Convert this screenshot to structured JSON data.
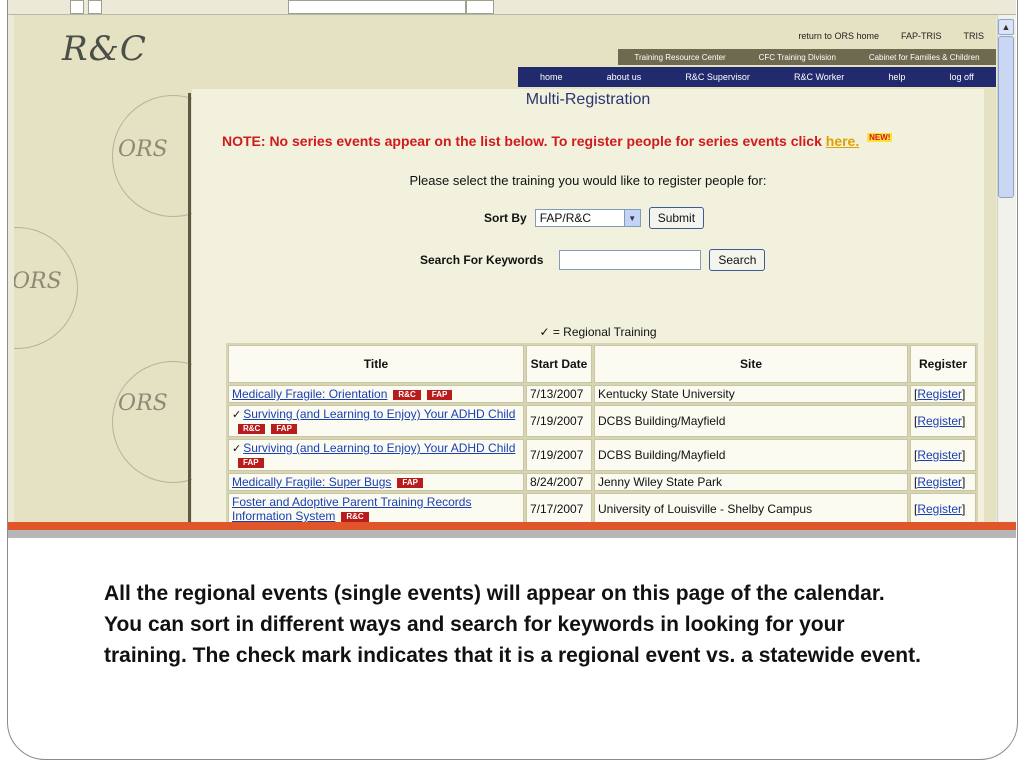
{
  "site": {
    "logo": "R&C",
    "watermark": "ORS"
  },
  "top_links": [
    "return to ORS home",
    "FAP-TRIS",
    "TRIS"
  ],
  "nav_secondary": [
    "Training Resource Center",
    "CFC Training Division",
    "Cabinet for Families & Children"
  ],
  "nav_primary": [
    "home",
    "about us",
    "R&C Supervisor",
    "R&C Worker",
    "help",
    "log off"
  ],
  "page": {
    "heading": "Multi-Registration",
    "note_text": "NOTE: No series events appear on the list below. To register people for series events click",
    "note_link": "here.",
    "note_badge": "NEW!",
    "prompt": "Please select the training you would like to register people for:",
    "sort_label": "Sort By",
    "sort_value": "FAP/R&C",
    "submit_label": "Submit",
    "search_label": "Search For Keywords",
    "search_value": "",
    "search_button": "Search",
    "legend": "✓ = Regional Training"
  },
  "table": {
    "headers": [
      "Title",
      "Start Date",
      "Site",
      "Register"
    ],
    "rows": [
      {
        "regional": false,
        "title": "Medically Fragile: Orientation",
        "badges": [
          "R&C",
          "FAP"
        ],
        "date": "7/13/2007",
        "site": "Kentucky State University",
        "register": "Register"
      },
      {
        "regional": true,
        "title": "Surviving (and Learning to Enjoy) Your ADHD Child",
        "badges": [
          "R&C",
          "FAP"
        ],
        "date": "7/19/2007",
        "site": "DCBS Building/Mayfield",
        "register": "Register"
      },
      {
        "regional": true,
        "title": "Surviving (and Learning to Enjoy) Your ADHD Child",
        "badges": [
          "FAP"
        ],
        "date": "7/19/2007",
        "site": "DCBS Building/Mayfield",
        "register": "Register"
      },
      {
        "regional": false,
        "title": "Medically Fragile: Super Bugs",
        "badges": [
          "FAP"
        ],
        "date": "8/24/2007",
        "site": "Jenny Wiley State Park",
        "register": "Register"
      },
      {
        "regional": false,
        "title": "Foster and Adoptive Parent Training Records Information System",
        "badges": [
          "R&C"
        ],
        "date": "7/17/2007",
        "site": "University of Louisville - Shelby Campus",
        "register": "Register"
      }
    ]
  },
  "caption": "All the regional events (single events) will appear on this page of the calendar.  You can sort in different ways and search for keywords in looking for your training.  The check mark indicates that it is a regional event vs. a statewide event."
}
